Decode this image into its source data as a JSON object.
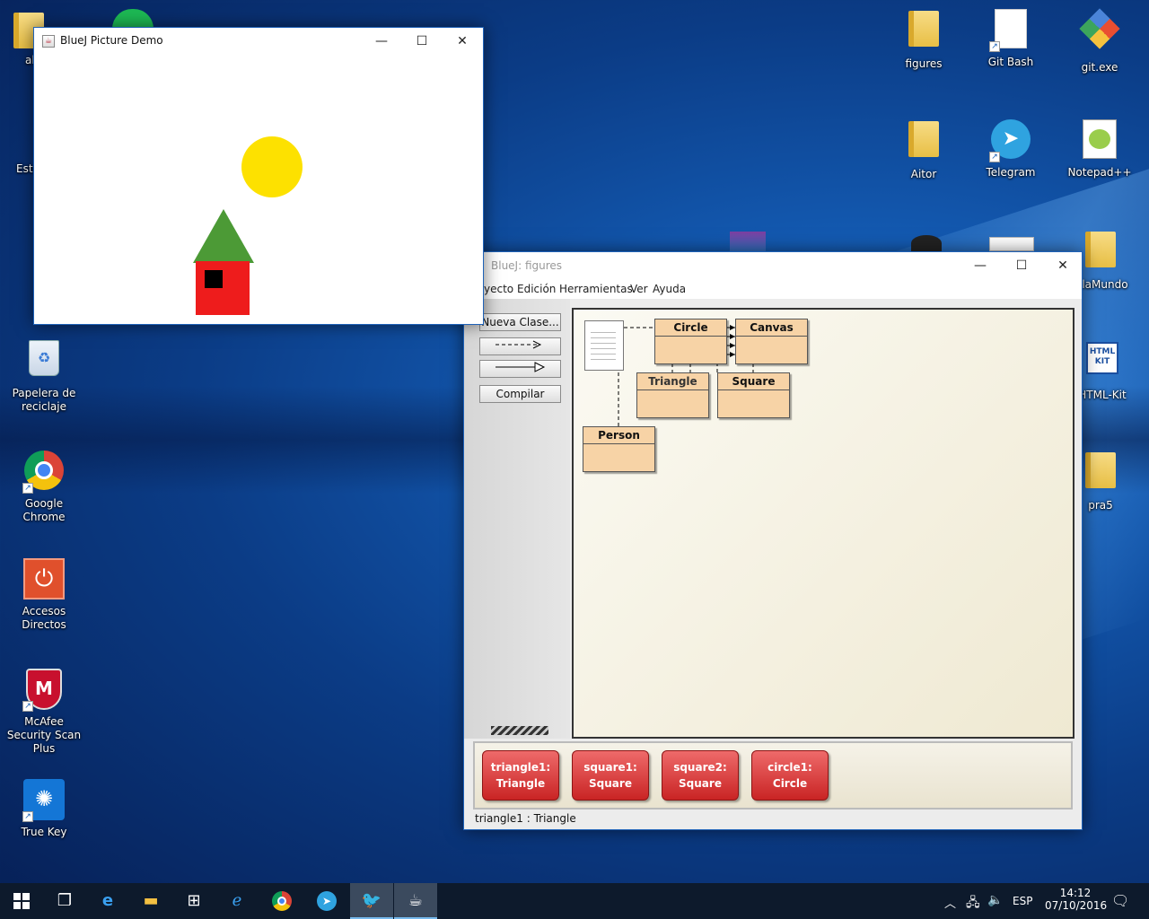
{
  "desktop": {
    "icons": [
      {
        "label": "al",
        "icon": "folder-icon"
      },
      {
        "label": "Este",
        "icon": "computer-icon"
      },
      {
        "label": "Papelera de reciclaje",
        "icon": "recycle-bin-icon"
      },
      {
        "label": "Google Chrome",
        "icon": "chrome-icon"
      },
      {
        "label": "Accesos Directos",
        "icon": "power-icon"
      },
      {
        "label": "McAfee Security Scan Plus",
        "icon": "mcafee-icon"
      },
      {
        "label": "True Key",
        "icon": "truekey-icon"
      },
      {
        "label": "figures",
        "icon": "folder-icon"
      },
      {
        "label": "Git Bash",
        "icon": "file-icon"
      },
      {
        "label": "git.exe",
        "icon": "git-icon"
      },
      {
        "label": "Aitor",
        "icon": "folder-icon"
      },
      {
        "label": "Telegram",
        "icon": "telegram-icon"
      },
      {
        "label": "Notepad++",
        "icon": "notepad-icon"
      },
      {
        "label": "olaMundo",
        "icon": "folder-icon"
      },
      {
        "label": "HTML-Kit",
        "icon": "htmlkit-icon"
      },
      {
        "label": "pra5",
        "icon": "pdf-icon"
      }
    ]
  },
  "picture_window": {
    "title": "BlueJ Picture Demo",
    "colors": {
      "sun": "#FDE100",
      "roof": "#4C9A36",
      "wall": "#EE1C1C",
      "window": "#000000"
    }
  },
  "bluej": {
    "title": "BlueJ:  figures",
    "menu": [
      "yecto",
      "Edición",
      "Herramientas",
      "Ver",
      "Ayuda"
    ],
    "toolbar": {
      "new_class": "Nueva Clase...",
      "compile": "Compilar"
    },
    "classes": [
      {
        "name": "Circle"
      },
      {
        "name": "Canvas"
      },
      {
        "name": "Triangle"
      },
      {
        "name": "Square"
      },
      {
        "name": "Person"
      }
    ],
    "objects": [
      {
        "line1": "triangle1:",
        "line2": "Triangle"
      },
      {
        "line1": "square1:",
        "line2": "Square"
      },
      {
        "line1": "square2:",
        "line2": "Square"
      },
      {
        "line1": "circle1:",
        "line2": "Circle"
      }
    ],
    "status": "triangle1 : Triangle"
  },
  "taskbar": {
    "lang": "ESP",
    "time": "14:12",
    "date": "07/10/2016"
  }
}
